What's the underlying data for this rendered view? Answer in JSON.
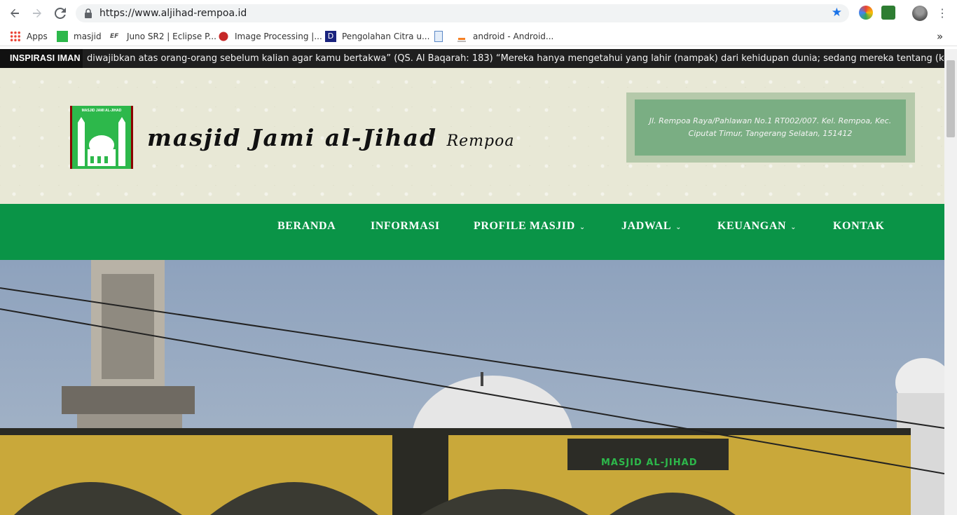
{
  "browser": {
    "url": "https://www.aljihad-rempoa.id",
    "bookmarks": [
      {
        "label": "Apps",
        "icon": "apps-grid-icon"
      },
      {
        "label": "masjid",
        "icon": "mosque-favicon"
      },
      {
        "label": "Juno SR2 | Eclipse P...",
        "icon": "eclipse-favicon"
      },
      {
        "label": "Image Processing |...",
        "icon": "red-dot-favicon"
      },
      {
        "label": "Pengolahan Citra u...",
        "icon": "d-favicon"
      },
      {
        "label": "",
        "icon": "document-icon"
      },
      {
        "label": "android - Android...",
        "icon": "stackoverflow-favicon"
      }
    ],
    "more_bookmarks": "»"
  },
  "ticker": {
    "label": "INSPIRASI IMAN",
    "text": "diwajibkan atas orang-orang sebelum kalian agar kamu bertakwa” (QS. Al Baqarah: 183)       “Mereka hanya mengetahui yang lahir (nampak) dari kehidupan dunia; sedang mereka tentang (kehidupan) akhirat adalah lalai.”"
  },
  "header": {
    "logo_caption": "MASJID JAMI AL-JIHAD",
    "site_title": "masjid Jami al-Jihad",
    "site_title_suffix": "Rempoa",
    "address_line1": "Jl. Rempoa Raya/Pahlawan No.1 RT002/007. Kel. Rempoa, Kec.",
    "address_line2": "Ciputat Timur, Tangerang Selatan, 151412"
  },
  "nav": {
    "items": [
      {
        "label": "BERANDA",
        "has_dropdown": false
      },
      {
        "label": "INFORMASI",
        "has_dropdown": false
      },
      {
        "label": "PROFILE MASJID",
        "has_dropdown": true
      },
      {
        "label": "JADWAL",
        "has_dropdown": true
      },
      {
        "label": "KEUANGAN",
        "has_dropdown": true
      },
      {
        "label": "KONTAK",
        "has_dropdown": false
      }
    ]
  },
  "hero": {
    "signboard_text": "MASJID AL-JIHAD"
  },
  "colors": {
    "nav_green": "#0a9447",
    "ticker_bg": "#1f1f1f",
    "header_bg": "#e8e8d6",
    "address_box": "#7aae83"
  }
}
